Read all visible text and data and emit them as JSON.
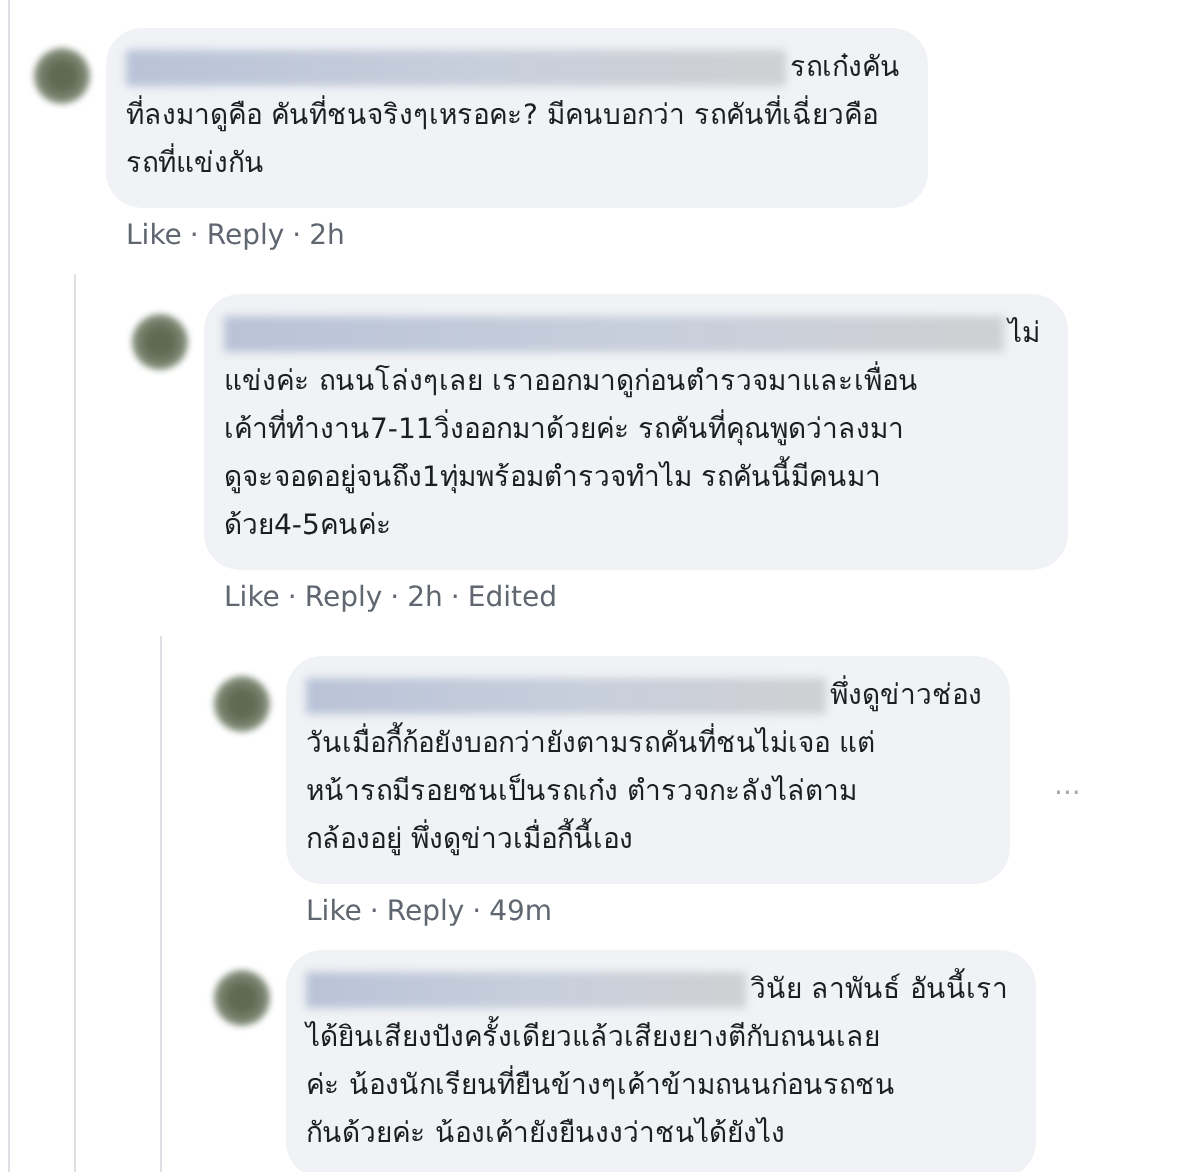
{
  "separator": "·",
  "comments": [
    {
      "lines": [
        "รถเก๋งคัน",
        "ที่ลงมาดูคือ คันที่ชนจริงๆเหรอคะ? มีคนบอกว่า รถคันที่เฉี่ยวคือ",
        "รถที่แข่งกัน"
      ],
      "actions": [
        "Like",
        "Reply",
        "2h"
      ],
      "replies": [
        {
          "lines": [
            "ไม่",
            "แข่งค่ะ ถนนโล่งๆเลย เราออกมาดูก่อนตำรวจมาและเพื่อน",
            "เค้าที่ทำงาน7-11วิ่งออกมาด้วยค่ะ รถคันที่คุณพูดว่าลงมา",
            "ดูจะจอดอยู่จนถึง1ทุ่มพร้อมตำรวจทำไม รถคันนี้มีคนมา",
            "ด้วย4-5คนค่ะ"
          ],
          "actions": [
            "Like",
            "Reply",
            "2h",
            "Edited"
          ],
          "replies": [
            {
              "lines": [
                "พึ่งดูข่าวช่อง",
                "วันเมื่อกี้ก้อยังบอกว่ายังตามรถคันที่ชนไม่เจอ แต่",
                "หน้ารถมีรอยชนเป็นรถเก๋ง ตำรวจกะลังไล่ตาม",
                "กล้องอยู่ พึ่งดูข่าวเมื่อกี้นี้เอง"
              ],
              "actions": [
                "Like",
                "Reply",
                "49m"
              ],
              "more": "···"
            },
            {
              "lines": [
                "วินัย ลาพันธ์ อันนี้เรา",
                "ได้ยินเสียงปังครั้งเดียวแล้วเสียงยางตีกับถนนเลย",
                "ค่ะ น้องนักเรียนที่ยืนข้างๆเค้าข้ามถนนก่อนรถชน",
                "กันด้วยค่ะ น้องเค้ายังยืนงงว่าชนได้ยังไง"
              ]
            }
          ]
        }
      ]
    }
  ]
}
